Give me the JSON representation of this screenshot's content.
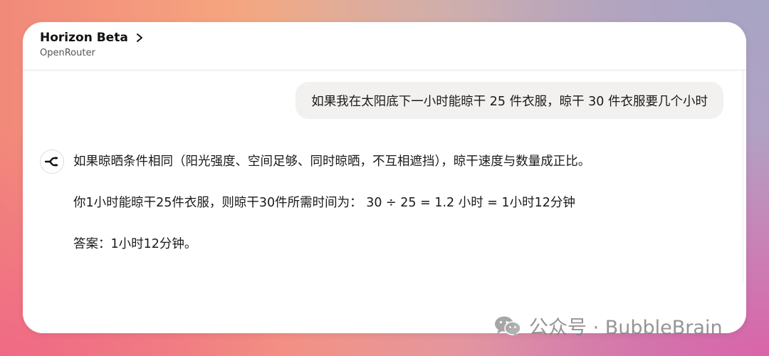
{
  "header": {
    "model_name": "Horizon Beta",
    "provider": "OpenRouter"
  },
  "messages": {
    "user": "如果我在太阳底下一小时能晾干 25 件衣服，晾干 30 件衣服要几个小时",
    "assistant": [
      "如果晾晒条件相同（阳光强度、空间足够、同时晾晒，不互相遮挡），晾干速度与数量成正比。",
      "你1小时能晾干25件衣服，则晾干30件所需时间为： 30 ÷ 25 = 1.2 小时 = 1小时12分钟",
      "答案：1小时12分钟。"
    ]
  },
  "watermark": {
    "text": "公众号 · BubbleBrain",
    "icon": "wechat-icon"
  },
  "icons": {
    "header": "chevron-right-icon",
    "avatar": "openrouter-logo-icon"
  }
}
